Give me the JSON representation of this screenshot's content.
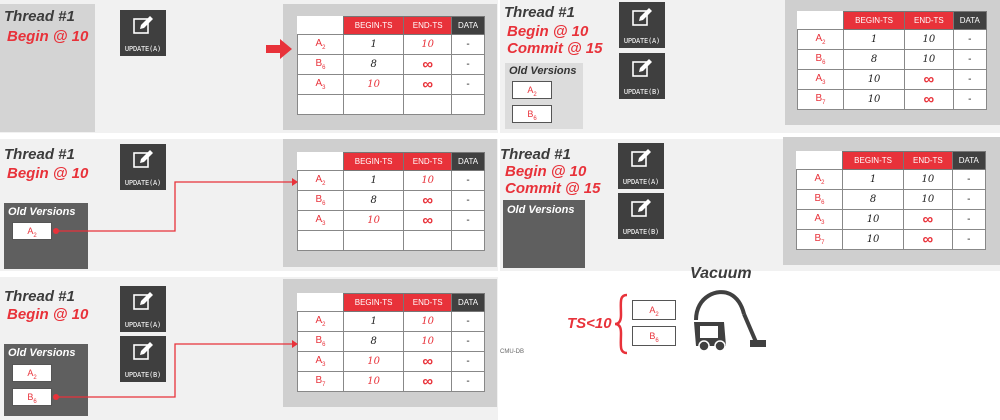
{
  "panels": [
    {
      "thread_title": "Thread #1",
      "begin": "Begin @ 10",
      "update_buttons": [
        {
          "label": "UPDATE(A)",
          "icon": "edit-icon"
        }
      ],
      "old_versions_title": "",
      "old_versions": [],
      "table": {
        "headers": [
          "BEGIN-TS",
          "END-TS",
          "DATA"
        ],
        "rows": [
          {
            "key": "A",
            "sub": "2",
            "begin": "1",
            "end": "10",
            "data": "-"
          },
          {
            "key": "B",
            "sub": "6",
            "begin": "8",
            "end": "∞",
            "data": "-"
          },
          {
            "key": "A",
            "sub": "3",
            "begin": "10",
            "end": "∞",
            "data": "-"
          },
          {
            "key": "",
            "sub": "",
            "begin": "",
            "end": "",
            "data": ""
          }
        ]
      }
    },
    {
      "thread_title": "Thread #1",
      "begin": "Begin @ 10",
      "update_buttons": [
        {
          "label": "UPDATE(A)",
          "icon": "edit-icon"
        }
      ],
      "old_versions_title": "Old Versions",
      "old_versions": [
        {
          "key": "A",
          "sub": "2"
        }
      ],
      "table": {
        "headers": [
          "BEGIN-TS",
          "END-TS",
          "DATA"
        ],
        "rows": [
          {
            "key": "A",
            "sub": "2",
            "begin": "1",
            "end": "10",
            "data": "-"
          },
          {
            "key": "B",
            "sub": "6",
            "begin": "8",
            "end": "∞",
            "data": "-"
          },
          {
            "key": "A",
            "sub": "3",
            "begin": "10",
            "end": "∞",
            "data": "-"
          },
          {
            "key": "",
            "sub": "",
            "begin": "",
            "end": "",
            "data": ""
          }
        ]
      }
    },
    {
      "thread_title": "Thread #1",
      "begin": "Begin @ 10",
      "update_buttons": [
        {
          "label": "UPDATE(A)",
          "icon": "edit-icon"
        },
        {
          "label": "UPDATE(B)",
          "icon": "edit-icon"
        }
      ],
      "old_versions_title": "Old Versions",
      "old_versions": [
        {
          "key": "A",
          "sub": "2"
        },
        {
          "key": "B",
          "sub": "6"
        }
      ],
      "table": {
        "headers": [
          "BEGIN-TS",
          "END-TS",
          "DATA"
        ],
        "rows": [
          {
            "key": "A",
            "sub": "2",
            "begin": "1",
            "end": "10",
            "data": "-"
          },
          {
            "key": "B",
            "sub": "6",
            "begin": "8",
            "end": "10",
            "data": "-"
          },
          {
            "key": "A",
            "sub": "3",
            "begin": "10",
            "end": "∞",
            "data": "-"
          },
          {
            "key": "B",
            "sub": "7",
            "begin": "10",
            "end": "∞",
            "data": "-"
          }
        ]
      }
    },
    {
      "thread_title": "Thread #1",
      "begin": "Begin @ 10",
      "commit": "Commit @ 15",
      "update_buttons": [
        {
          "label": "UPDATE(A)",
          "icon": "edit-icon"
        },
        {
          "label": "UPDATE(B)",
          "icon": "edit-icon"
        }
      ],
      "old_versions_title": "Old Versions",
      "old_versions": [
        {
          "key": "A",
          "sub": "2"
        },
        {
          "key": "B",
          "sub": "6"
        }
      ],
      "table": {
        "headers": [
          "BEGIN-TS",
          "END-TS",
          "DATA"
        ],
        "rows": [
          {
            "key": "A",
            "sub": "2",
            "begin": "1",
            "end": "10",
            "data": "-"
          },
          {
            "key": "B",
            "sub": "6",
            "begin": "8",
            "end": "10",
            "data": "-"
          },
          {
            "key": "A",
            "sub": "3",
            "begin": "10",
            "end": "∞",
            "data": "-"
          },
          {
            "key": "B",
            "sub": "7",
            "begin": "10",
            "end": "∞",
            "data": "-"
          }
        ]
      }
    },
    {
      "thread_title": "Thread #1",
      "begin": "Begin @ 10",
      "commit": "Commit @ 15",
      "update_buttons": [
        {
          "label": "UPDATE(A)",
          "icon": "edit-icon"
        },
        {
          "label": "UPDATE(B)",
          "icon": "edit-icon"
        }
      ],
      "old_versions_title": "Old Versions",
      "old_versions": [],
      "table": {
        "headers": [
          "BEGIN-TS",
          "END-TS",
          "DATA"
        ],
        "rows": [
          {
            "key": "A",
            "sub": "2",
            "begin": "1",
            "end": "10",
            "data": "-"
          },
          {
            "key": "B",
            "sub": "6",
            "begin": "8",
            "end": "10",
            "data": "-"
          },
          {
            "key": "A",
            "sub": "3",
            "begin": "10",
            "end": "∞",
            "data": "-"
          },
          {
            "key": "B",
            "sub": "7",
            "begin": "10",
            "end": "∞",
            "data": "-"
          }
        ]
      }
    }
  ],
  "vacuum": {
    "title": "Vacuum",
    "condition": "TS<10",
    "chips": [
      {
        "key": "A",
        "sub": "2"
      },
      {
        "key": "B",
        "sub": "6"
      }
    ],
    "icon": "vacuum-cleaner-icon"
  },
  "footer": "CMU-DB",
  "colors": {
    "accent": "#e8323a",
    "dark": "#404040",
    "panel": "#f1f1f1",
    "table_block": "#cfcfcf"
  }
}
